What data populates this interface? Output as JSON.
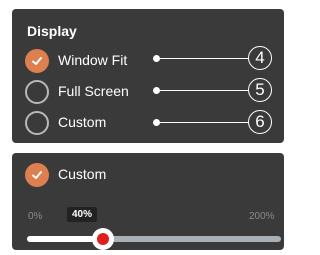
{
  "display_panel": {
    "heading": "Display",
    "options": [
      {
        "label": "Window Fit",
        "selected": true,
        "callout": "4"
      },
      {
        "label": "Full Screen",
        "selected": false,
        "callout": "5"
      },
      {
        "label": "Custom",
        "selected": false,
        "callout": "6"
      }
    ]
  },
  "custom_panel": {
    "option_label": "Custom",
    "option_selected": true,
    "slider": {
      "min_label": "0%",
      "max_label": "200%",
      "value_label": "40%",
      "value_fraction": 0.3
    }
  },
  "colors": {
    "panel_bg": "#3a3a3a",
    "accent": "#dd7f4e",
    "slider_thumb_center": "#e11d1d",
    "track": "#a9b1b7"
  },
  "icons": {
    "checkmark": "checkmark-icon"
  }
}
